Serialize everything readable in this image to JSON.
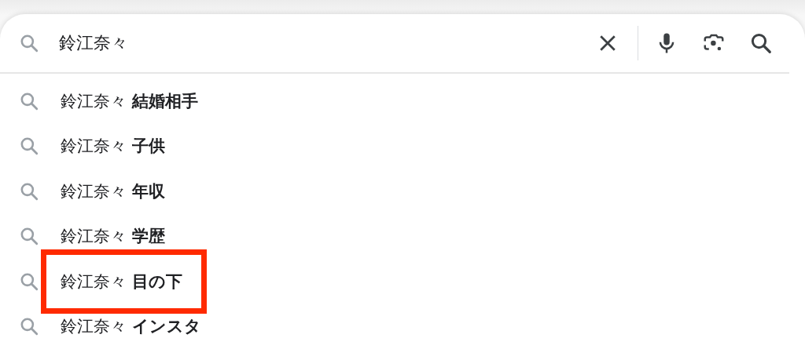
{
  "search": {
    "value": "鈴江奈々"
  },
  "suggestions": [
    {
      "text": "鈴江奈々 **結婚相手**",
      "highlighted": false
    },
    {
      "text": "鈴江奈々 **子供**",
      "highlighted": false
    },
    {
      "text": "鈴江奈々 **年収**",
      "highlighted": false
    },
    {
      "text": "鈴江奈々 **学歴**",
      "highlighted": false
    },
    {
      "text": "鈴江奈々 **目の下**",
      "highlighted": true
    },
    {
      "text": "鈴江奈々 **インスタ**",
      "highlighted": false
    }
  ]
}
